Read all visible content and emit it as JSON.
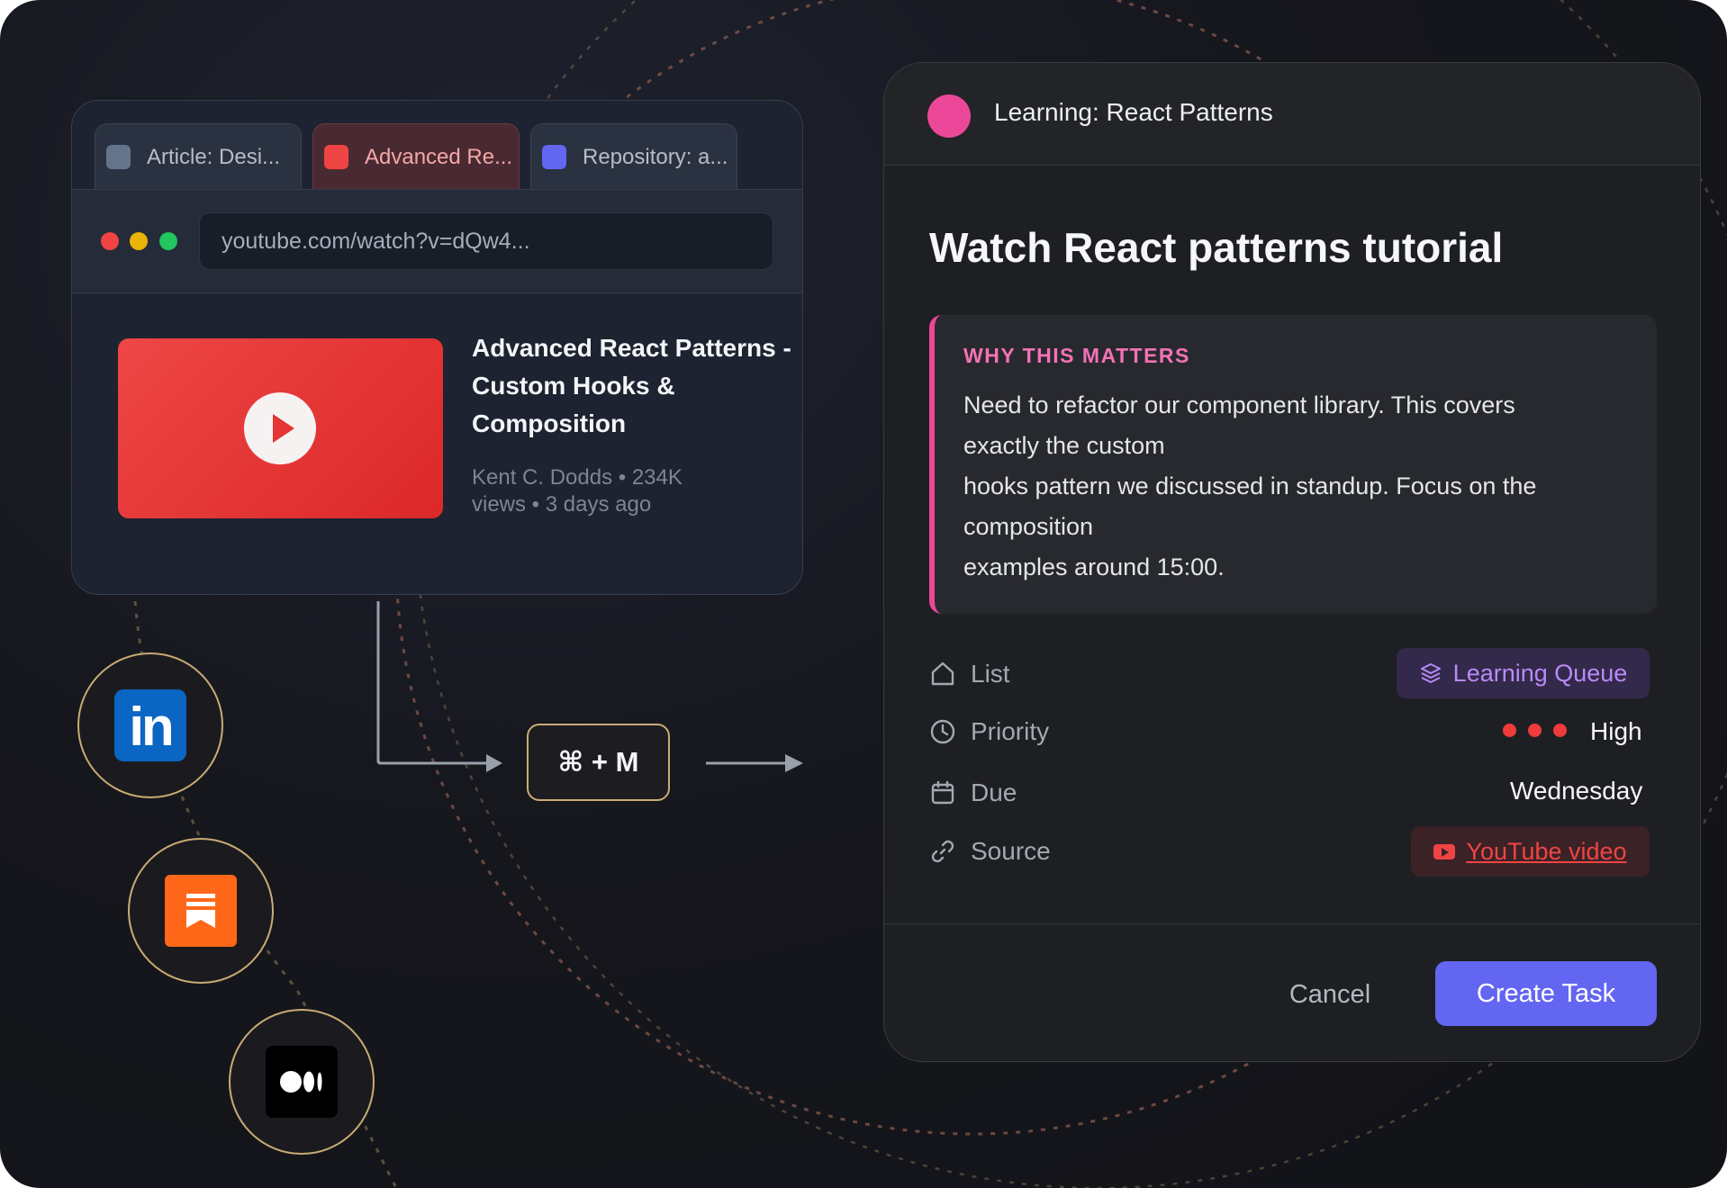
{
  "browser": {
    "tabs": [
      {
        "label": "Article: Desi...",
        "icon": "article-favicon-icon",
        "color": "#64748b"
      },
      {
        "label": "Advanced Re...",
        "icon": "youtube-favicon-icon",
        "color": "#ef4444",
        "active": true
      },
      {
        "label": "Repository: a...",
        "icon": "repository-favicon-icon",
        "color": "#6366f1"
      }
    ],
    "traffic_lights": [
      "#ef4444",
      "#eab308",
      "#22c55e"
    ],
    "url": "youtube.com/watch?v=dQw4...",
    "video": {
      "title": "Advanced React Patterns - Custom Hooks & Composition",
      "meta": "Kent C. Dodds • 234K views • 3 days ago"
    }
  },
  "apps": [
    {
      "name": "LinkedIn",
      "icon": "linkedin-icon",
      "glyph": "in"
    },
    {
      "name": "Substack",
      "icon": "substack-icon"
    },
    {
      "name": "Medium",
      "icon": "medium-icon"
    }
  ],
  "shortcut": {
    "label": "⌘ + M"
  },
  "modal": {
    "header_title": "Learning: React Patterns",
    "accent": "#ec4899",
    "task_title": "Watch React patterns tutorial",
    "why": {
      "label": "WHY THIS MATTERS",
      "lines": [
        "Need to refactor our component library. This covers",
        "exactly the custom",
        "hooks pattern we discussed in standup. Focus on the",
        "composition",
        "examples around 15:00."
      ]
    },
    "fields": {
      "list": {
        "label": "List",
        "value": "Learning Queue"
      },
      "priority": {
        "label": "Priority",
        "value": "High",
        "dots": 3
      },
      "due": {
        "label": "Due",
        "value": "Wednesday"
      },
      "source": {
        "label": "Source",
        "value": "YouTube video"
      }
    },
    "buttons": {
      "cancel": "Cancel",
      "create": "Create Task"
    },
    "primary_color": "#6366f1"
  }
}
